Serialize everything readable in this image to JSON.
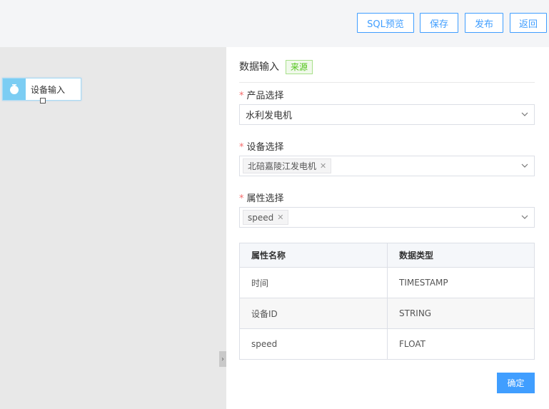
{
  "toolbar": {
    "sql_preview_label": "SQL预览",
    "save_label": "保存",
    "publish_label": "发布",
    "back_label": "返回"
  },
  "canvas": {
    "node_label": "设备输入",
    "node_icon": "device-input-icon",
    "collapse_glyph": "›"
  },
  "panel": {
    "title": "数据输入",
    "source_tag": "来源",
    "product_label": "产品选择",
    "product_value": "水利发电机",
    "device_label": "设备选择",
    "device_chips": [
      "北碚嘉陵江发电机"
    ],
    "attr_label": "属性选择",
    "attr_chips": [
      "speed"
    ],
    "required_mark": "*",
    "table": {
      "headers": [
        "属性名称",
        "数据类型"
      ],
      "rows": [
        [
          "时间",
          "TIMESTAMP"
        ],
        [
          "设备ID",
          "STRING"
        ],
        [
          "speed",
          "FLOAT"
        ]
      ]
    },
    "confirm_label": "确定"
  },
  "colors": {
    "primary": "#409eff",
    "node_icon_bg": "#7ccdf3",
    "source_tag": "#52c41a",
    "required": "#f56c6c"
  }
}
